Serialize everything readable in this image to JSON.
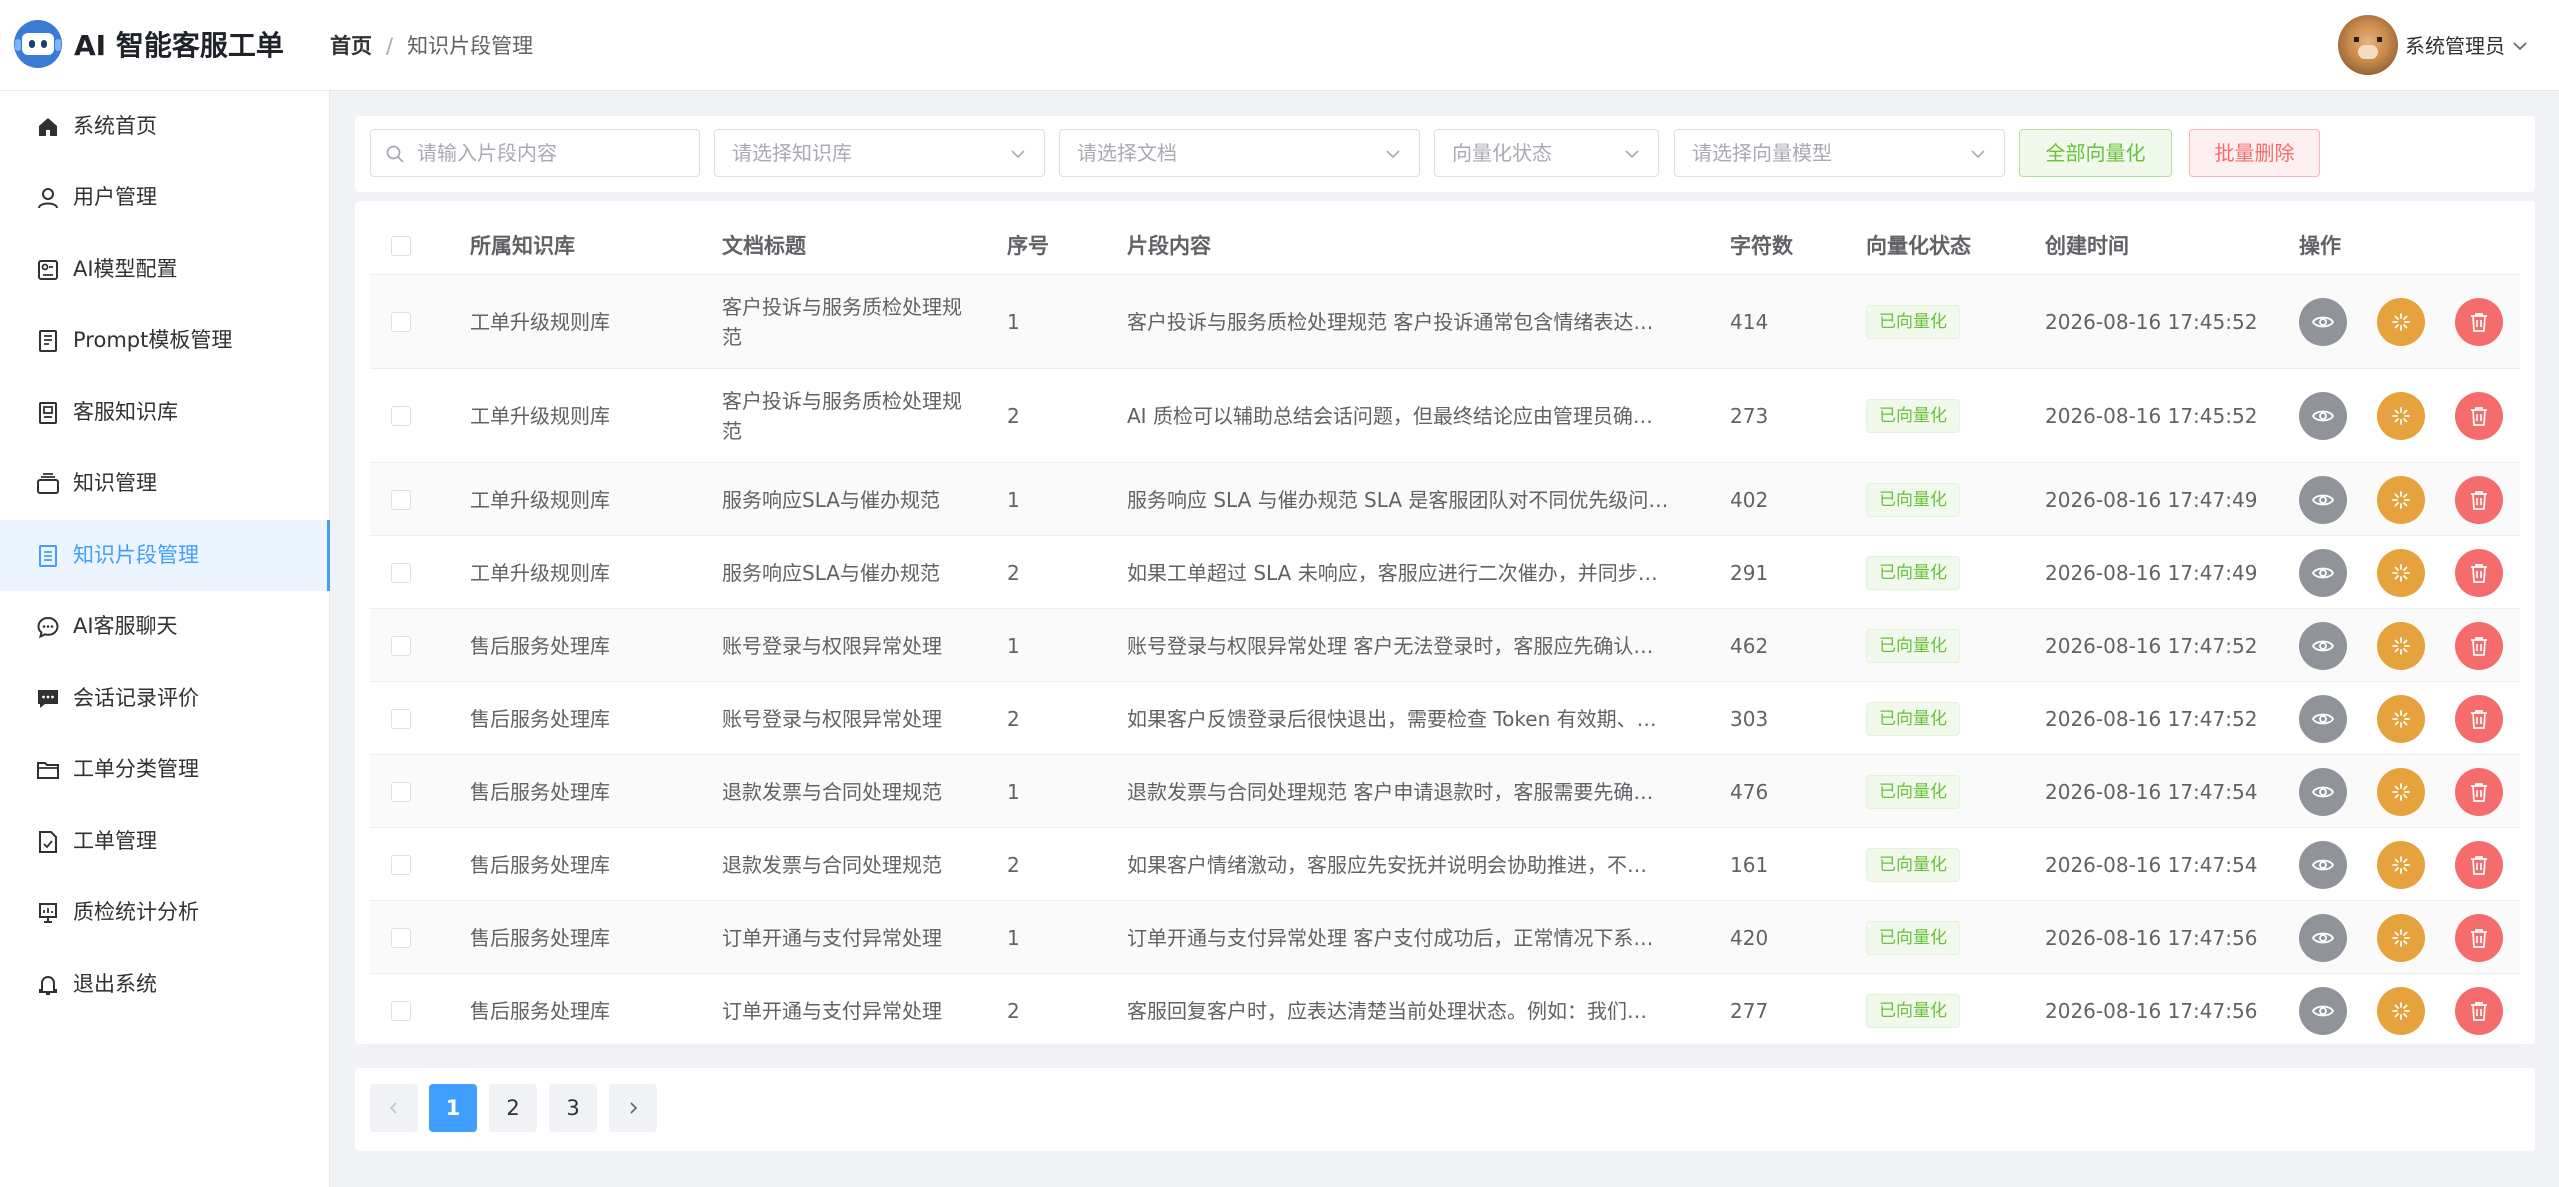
{
  "app": {
    "title": "AI 智能客服工单"
  },
  "breadcrumb": {
    "home": "首页",
    "separator": "/",
    "current": "知识片段管理"
  },
  "user": {
    "name": "系统管理员"
  },
  "colors": {
    "primary": "#409eff",
    "success": "#67c23a",
    "warning": "#e6a23c",
    "danger": "#f56c6c",
    "info": "#909399"
  },
  "sidebar": {
    "items": [
      {
        "label": "系统首页",
        "icon": "home-icon"
      },
      {
        "label": "用户管理",
        "icon": "user-icon"
      },
      {
        "label": "AI模型配置",
        "icon": "model-config-icon"
      },
      {
        "label": "Prompt模板管理",
        "icon": "template-icon"
      },
      {
        "label": "客服知识库",
        "icon": "knowledge-base-icon"
      },
      {
        "label": "知识管理",
        "icon": "knowledge-icon"
      },
      {
        "label": "知识片段管理",
        "icon": "document-icon",
        "active": true
      },
      {
        "label": "AI客服聊天",
        "icon": "chat-icon"
      },
      {
        "label": "会话记录评价",
        "icon": "comment-icon"
      },
      {
        "label": "工单分类管理",
        "icon": "folder-icon"
      },
      {
        "label": "工单管理",
        "icon": "ticket-icon"
      },
      {
        "label": "质检统计分析",
        "icon": "chart-icon"
      },
      {
        "label": "退出系统",
        "icon": "bell-icon"
      }
    ]
  },
  "filters": {
    "content_placeholder": "请输入片段内容",
    "kb_placeholder": "请选择知识库",
    "doc_placeholder": "请选择文档",
    "status_placeholder": "向量化状态",
    "model_placeholder": "请选择向量模型",
    "vectorize_all_label": "全部向量化",
    "batch_delete_label": "批量删除"
  },
  "table": {
    "headers": {
      "kb": "所属知识库",
      "doc": "文档标题",
      "seq": "序号",
      "content": "片段内容",
      "chars": "字符数",
      "status": "向量化状态",
      "created": "创建时间",
      "ops": "操作"
    },
    "rows": [
      {
        "kb": "工单升级规则库",
        "doc": "客户投诉与服务质检处理规范",
        "seq": "1",
        "content": "客户投诉与服务质检处理规范 客户投诉通常包含情绪表达…",
        "chars": "414",
        "status": "已向量化",
        "created": "2026-08-16 17:45:52"
      },
      {
        "kb": "工单升级规则库",
        "doc": "客户投诉与服务质检处理规范",
        "seq": "2",
        "content": "AI 质检可以辅助总结会话问题，但最终结论应由管理员确…",
        "chars": "273",
        "status": "已向量化",
        "created": "2026-08-16 17:45:52"
      },
      {
        "kb": "工单升级规则库",
        "doc": "服务响应SLA与催办规范",
        "seq": "1",
        "content": "服务响应 SLA 与催办规范 SLA 是客服团队对不同优先级问…",
        "chars": "402",
        "status": "已向量化",
        "created": "2026-08-16 17:47:49"
      },
      {
        "kb": "工单升级规则库",
        "doc": "服务响应SLA与催办规范",
        "seq": "2",
        "content": "如果工单超过 SLA 未响应，客服应进行二次催办，并同步…",
        "chars": "291",
        "status": "已向量化",
        "created": "2026-08-16 17:47:49"
      },
      {
        "kb": "售后服务处理库",
        "doc": "账号登录与权限异常处理",
        "seq": "1",
        "content": "账号登录与权限异常处理 客户无法登录时，客服应先确认…",
        "chars": "462",
        "status": "已向量化",
        "created": "2026-08-16 17:47:52"
      },
      {
        "kb": "售后服务处理库",
        "doc": "账号登录与权限异常处理",
        "seq": "2",
        "content": "如果客户反馈登录后很快退出，需要检查 Token 有效期、…",
        "chars": "303",
        "status": "已向量化",
        "created": "2026-08-16 17:47:52"
      },
      {
        "kb": "售后服务处理库",
        "doc": "退款发票与合同处理规范",
        "seq": "1",
        "content": "退款发票与合同处理规范 客户申请退款时，客服需要先确…",
        "chars": "476",
        "status": "已向量化",
        "created": "2026-08-16 17:47:54"
      },
      {
        "kb": "售后服务处理库",
        "doc": "退款发票与合同处理规范",
        "seq": "2",
        "content": "如果客户情绪激动，客服应先安抚并说明会协助推进，不…",
        "chars": "161",
        "status": "已向量化",
        "created": "2026-08-16 17:47:54"
      },
      {
        "kb": "售后服务处理库",
        "doc": "订单开通与支付异常处理",
        "seq": "1",
        "content": "订单开通与支付异常处理 客户支付成功后，正常情况下系…",
        "chars": "420",
        "status": "已向量化",
        "created": "2026-08-16 17:47:56"
      },
      {
        "kb": "售后服务处理库",
        "doc": "订单开通与支付异常处理",
        "seq": "2",
        "content": "客服回复客户时，应表达清楚当前处理状态。例如：我们…",
        "chars": "277",
        "status": "已向量化",
        "created": "2026-08-16 17:47:56"
      }
    ]
  },
  "pagination": {
    "pages": [
      "1",
      "2",
      "3"
    ],
    "current": "1"
  }
}
